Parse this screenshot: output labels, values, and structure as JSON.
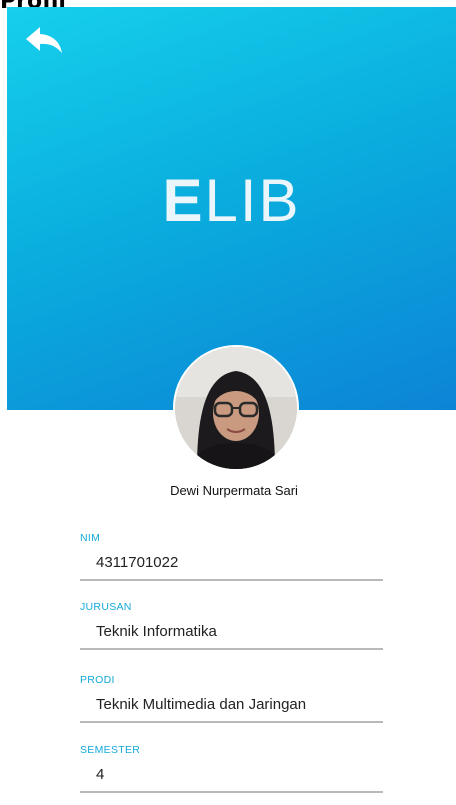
{
  "screen_caption": "Profil",
  "header": {
    "logo_first": "E",
    "logo_rest": "LIB",
    "colors": {
      "gradient_start": "#16d0ec",
      "gradient_end": "#0c84d6"
    }
  },
  "icons": {
    "back": "back-arrow-icon",
    "avatar": "user-photo-avatar"
  },
  "profile": {
    "name": "Dewi Nurpermata Sari",
    "fields": [
      {
        "label": "NIM",
        "value": "4311701022"
      },
      {
        "label": "JURUSAN",
        "value": "Teknik Informatika"
      },
      {
        "label": "PRODI",
        "value": "Teknik Multimedia dan Jaringan"
      },
      {
        "label": "SEMESTER",
        "value": "4"
      }
    ]
  },
  "colors": {
    "label": "#15a9d8",
    "divider": "#b9b9b9"
  }
}
